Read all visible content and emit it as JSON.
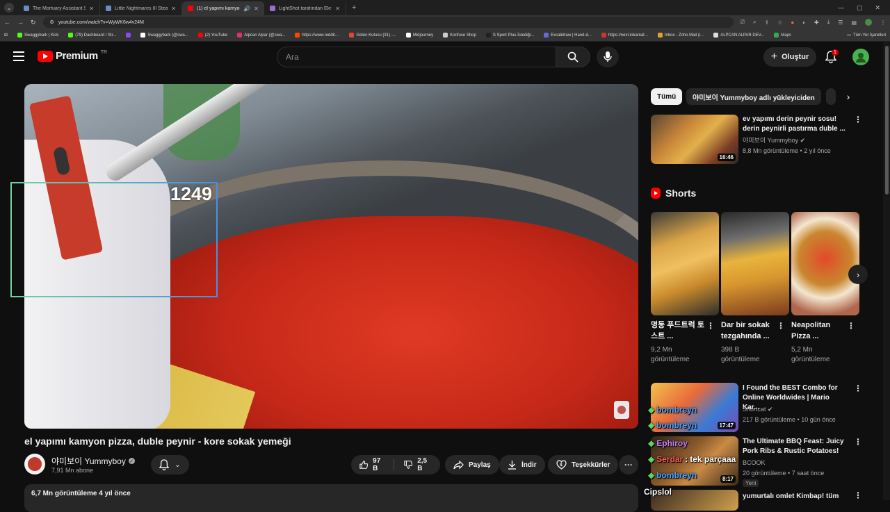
{
  "browser": {
    "tabs": [
      {
        "title": "The Mortuary Assistant Steam'de",
        "favicon_color": "#6b8cbf",
        "active": false
      },
      {
        "title": "Little Nightmares III Steam'de",
        "favicon_color": "#6b8cbf",
        "active": false
      },
      {
        "title": "(1) el yapımı kamyon pizza",
        "favicon_color": "#ff0000",
        "active": true
      },
      {
        "title": "LightShot tarafından Ekran Görü",
        "favicon_color": "#9b6bd6",
        "active": false
      }
    ],
    "url": "youtube.com/watch?v=WyWK6w4v24M",
    "bookmarks": [
      {
        "label": "Swaggybark | Kick",
        "color": "#53fc18"
      },
      {
        "label": "(79) Dashboard / Str...",
        "color": "#53fc18"
      },
      {
        "label": "",
        "color": "#9146ff"
      },
      {
        "label": "Swaggybark (@swa...",
        "color": "#ffffff"
      },
      {
        "label": "(2) YouTube",
        "color": "#ff0000"
      },
      {
        "label": "Alpcan Alpar (@swa...",
        "color": "#e1306c"
      },
      {
        "label": "https://www.reddit....",
        "color": "#ff4500"
      },
      {
        "label": "Gelen Kutusu (31) -...",
        "color": "#ea4335"
      },
      {
        "label": "Midjourney",
        "color": "#ffffff"
      },
      {
        "label": "Konfuse Shop",
        "color": "#cccccc"
      },
      {
        "label": "S Sport Plus-İstediği...",
        "color": "#222222"
      },
      {
        "label": "Excalidraw | Hand-d...",
        "color": "#6965db"
      },
      {
        "label": "https://next.inkamat...",
        "color": "#cc3333"
      },
      {
        "label": "Inbox - Zoho Mail (i...",
        "color": "#e0a030"
      },
      {
        "label": "ALPCAN ALPAR DEV...",
        "color": "#dddddd"
      },
      {
        "label": "Maps",
        "color": "#34a853"
      }
    ],
    "all_bookmarks": "Tüm Yer İşaretleri"
  },
  "header": {
    "logo_text": "Premium",
    "country_code": "TR",
    "search_placeholder": "Ara",
    "create_label": "Oluştur",
    "notification_count": "1"
  },
  "player": {
    "overlay_number": "1249"
  },
  "video": {
    "title": "el yapımı kamyon pizza, duble peynir - kore sokak yemeği",
    "channel": "야미보이 Yummyboy",
    "subscribers": "7,91 Mn abone",
    "likes": "97 B",
    "dislikes": "2,5 B",
    "share_label": "Paylaş",
    "download_label": "İndir",
    "thanks_label": "Teşekkürler",
    "views_date": "6,7 Mn görüntüleme  4 yıl önce"
  },
  "filters": [
    {
      "label": "Tümü",
      "active": true
    },
    {
      "label": "야미보이 Yummyboy adlı yükleyiciden",
      "active": false
    }
  ],
  "recommendations": [
    {
      "title": "ev yapımı derin peynir sosu! derin peynirli pastırma duble ...",
      "channel": "야미보이 Yummyboy",
      "verified": true,
      "meta": "8,8 Mn görüntüleme • 2 yıl önce",
      "duration": "16:46"
    },
    {
      "title": "I Found the BEST Combo for Online Worldwides | Mario Kar...",
      "channel": "Shortcat",
      "verified": true,
      "meta": "217 B görüntüleme • 10 gün önce",
      "duration": "17:47"
    },
    {
      "title": "The Ultimate BBQ Feast: Juicy Pork Ribs & Rustic Potatoes!",
      "channel": "BCOOK",
      "verified": false,
      "meta": "20 görüntüleme • 7 saat önce",
      "duration": "8:17",
      "badge": "Yeni"
    },
    {
      "title": "yumurtalı omlet Kimbap! tüm",
      "channel": "",
      "verified": false,
      "meta": "",
      "duration": ""
    }
  ],
  "shorts": {
    "heading": "Shorts",
    "items": [
      {
        "title": "명동 푸드트럭 토스트 ...",
        "views": "9,2 Mn görüntüleme"
      },
      {
        "title": "Dar bir sokak tezgahında ...",
        "views": "398 B görüntüleme"
      },
      {
        "title": "Neapolitan Pizza ...",
        "views": "5,2 Mn görüntüleme"
      }
    ]
  },
  "chat_overlay": {
    "lines": [
      {
        "user": "bombreyn",
        "color": "#4aa3ff",
        "text": ""
      },
      {
        "user": "bombreyn",
        "color": "#4aa3ff",
        "text": ""
      },
      {
        "user": "Ephiroy",
        "color": "#c77dff",
        "text": ""
      },
      {
        "user": "Serdar",
        "color": "#ff5a5a",
        "text": "tek parçaaa"
      },
      {
        "user": "bombreyn",
        "color": "#4aa3ff",
        "text": ""
      },
      {
        "user": "Cipslol",
        "color": "#ffffff",
        "text": ""
      }
    ]
  },
  "colors": {
    "accent_red": "#ff0000",
    "background": "#0f0f0f",
    "chip": "#272727"
  }
}
